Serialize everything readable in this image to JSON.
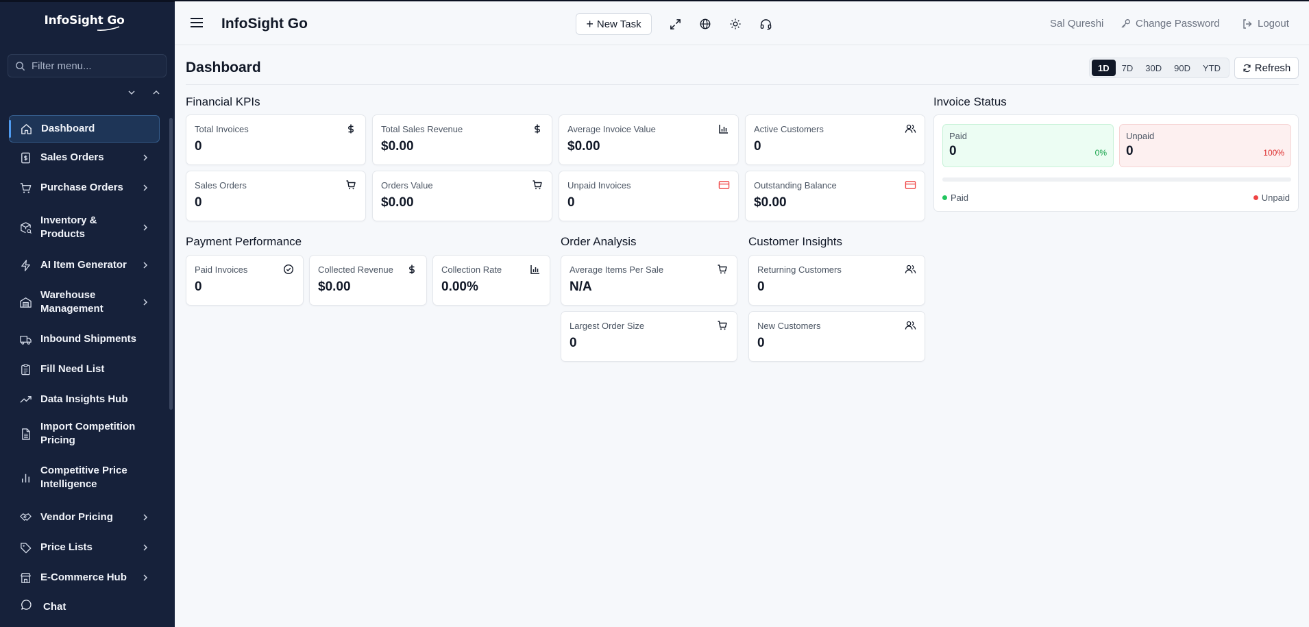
{
  "sidebar": {
    "logo": "InfoSight Go",
    "filter_placeholder": "Filter menu...",
    "items": [
      {
        "label": "Dashboard",
        "icon": "home-icon"
      },
      {
        "label": "Sales Orders",
        "icon": "invoice-icon"
      },
      {
        "label": "Purchase Orders",
        "icon": "cart-icon"
      },
      {
        "label": "Inventory & Products",
        "icon": "package-search-icon"
      },
      {
        "label": "AI Item Generator",
        "icon": "bolt-icon"
      },
      {
        "label": "Warehouse Management",
        "icon": "warehouse-icon"
      },
      {
        "label": "Inbound Shipments",
        "icon": "truck-icon"
      },
      {
        "label": "Fill Need List",
        "icon": "clipboard-list-icon"
      },
      {
        "label": "Data Insights Hub",
        "icon": "trending-up-icon"
      },
      {
        "label": "Import Competition Pricing",
        "icon": "file-spreadsheet-icon"
      },
      {
        "label": "Competitive Price Intelligence",
        "icon": "bar-chart-icon"
      },
      {
        "label": "Vendor Pricing",
        "icon": "handshake-icon"
      },
      {
        "label": "Price Lists",
        "icon": "tag-icon"
      },
      {
        "label": "E-Commerce Hub",
        "icon": "store-icon"
      }
    ],
    "chat_label": "Chat"
  },
  "header": {
    "title": "InfoSight Go",
    "new_task_label": "New Task",
    "user_name": "Sal Qureshi",
    "change_password_label": "Change Password",
    "logout_label": "Logout"
  },
  "dashboard": {
    "title": "Dashboard",
    "ranges": [
      "1D",
      "7D",
      "30D",
      "90D",
      "YTD"
    ],
    "active_range": "1D",
    "refresh_label": "Refresh"
  },
  "financial_kpis": {
    "title": "Financial KPIs",
    "cards": [
      {
        "label": "Total Invoices",
        "value": "0",
        "icon": "dollar-icon"
      },
      {
        "label": "Total Sales Revenue",
        "value": "$0.00",
        "icon": "dollar-icon"
      },
      {
        "label": "Average Invoice Value",
        "value": "$0.00",
        "icon": "bar-chart-icon"
      },
      {
        "label": "Active Customers",
        "value": "0",
        "icon": "users-icon"
      },
      {
        "label": "Sales Orders",
        "value": "0",
        "icon": "cart-icon"
      },
      {
        "label": "Orders Value",
        "value": "$0.00",
        "icon": "cart-icon"
      },
      {
        "label": "Unpaid Invoices",
        "value": "0",
        "icon": "credit-card-icon"
      },
      {
        "label": "Outstanding Balance",
        "value": "$0.00",
        "icon": "credit-card-icon"
      }
    ]
  },
  "payment_performance": {
    "title": "Payment Performance",
    "cards": [
      {
        "label": "Paid Invoices",
        "value": "0",
        "icon": "check-circle-icon"
      },
      {
        "label": "Collected Revenue",
        "value": "$0.00",
        "icon": "dollar-icon"
      },
      {
        "label": "Collection Rate",
        "value": "0.00%",
        "icon": "bar-chart-icon"
      }
    ]
  },
  "order_analysis": {
    "title": "Order Analysis",
    "cards": [
      {
        "label": "Average Items Per Sale",
        "value": "N/A",
        "icon": "cart-icon"
      },
      {
        "label": "Largest Order Size",
        "value": "0",
        "icon": "cart-icon"
      }
    ]
  },
  "customer_insights": {
    "title": "Customer Insights",
    "cards": [
      {
        "label": "Returning Customers",
        "value": "0",
        "icon": "users-icon"
      },
      {
        "label": "New Customers",
        "value": "0",
        "icon": "users-icon"
      }
    ]
  },
  "invoice_status": {
    "title": "Invoice Status",
    "paid": {
      "label": "Paid",
      "value": "0",
      "percent": "0%"
    },
    "unpaid": {
      "label": "Unpaid",
      "value": "0",
      "percent": "100%"
    },
    "paid_fraction": 0,
    "legend_paid": "Paid",
    "legend_unpaid": "Unpaid",
    "colors": {
      "paid": "#22c55e",
      "unpaid": "#ef4444"
    }
  },
  "colors": {
    "sidebar_bg": "#16213a",
    "accent": "#4f9bf0",
    "danger": "#ef4444",
    "success": "#22c55e"
  }
}
